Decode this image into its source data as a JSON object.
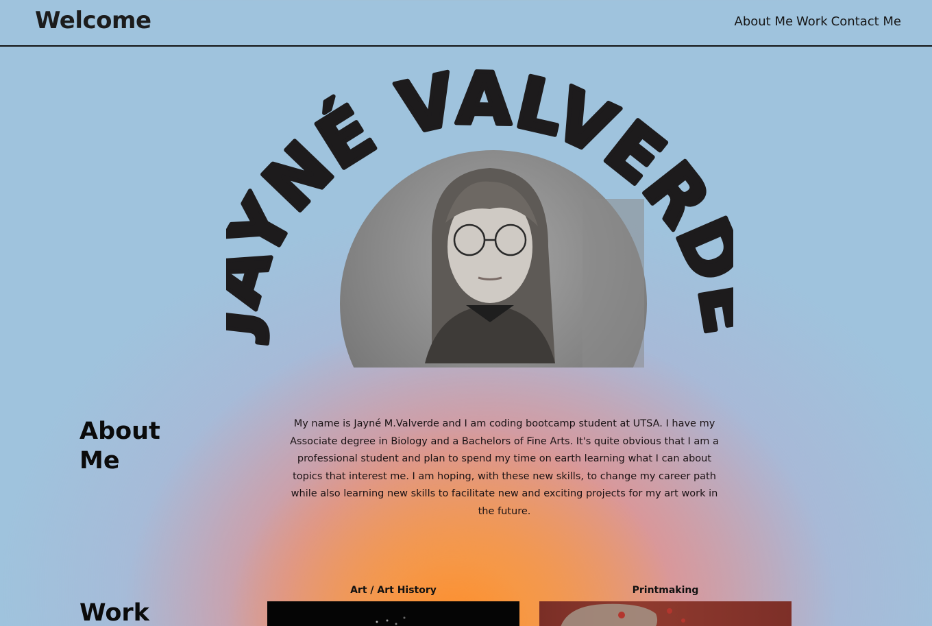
{
  "nav": {
    "brand": "Welcome",
    "links": [
      "About Me",
      "Work",
      "Contact Me"
    ]
  },
  "hero": {
    "name": "JAYNÉ VALVERDE",
    "photo_alt": "Portrait of Jayné Valverde"
  },
  "about": {
    "heading": "About Me",
    "text": "My name is Jayné M.Valverde and I am coding bootcamp student at UTSA. I have my Associate degree in Biology and a Bachelors of Fine Arts. It's quite obvious that I am a professional student and plan to spend my time on earth learning what I can about topics that interest me. I am hoping, with these new skills, to change my career path while also learning new skills to facilitate new and exciting projects for my art work in the future."
  },
  "work": {
    "heading": "Work",
    "cards": [
      {
        "title": "Art / Art History"
      },
      {
        "title": "Printmaking"
      }
    ]
  }
}
